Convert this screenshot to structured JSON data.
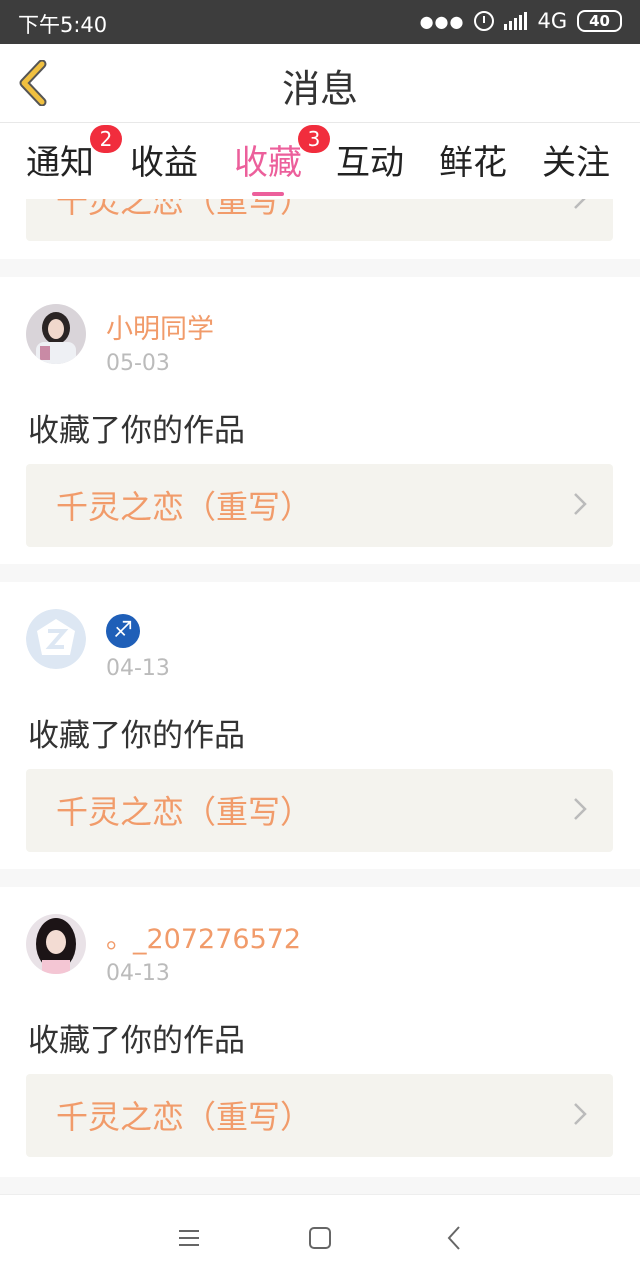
{
  "status_bar": {
    "time": "下午5:40",
    "network": "4G",
    "battery": "40"
  },
  "header": {
    "title": "消息"
  },
  "tabs": [
    {
      "label": "通知",
      "badge": "2",
      "active": false
    },
    {
      "label": "收益",
      "badge": "",
      "active": false
    },
    {
      "label": "收藏",
      "badge": "3",
      "active": true
    },
    {
      "label": "互动",
      "badge": "",
      "active": false
    },
    {
      "label": "鲜花",
      "badge": "",
      "active": false
    },
    {
      "label": "关注",
      "badge": "",
      "active": false
    }
  ],
  "feed": {
    "partial_item": {
      "work_title": "千灵之恋（重写）"
    },
    "items": [
      {
        "username": "小明同学",
        "date": "05-03",
        "action": "收藏了你的作品",
        "work_title": "千灵之恋（重写）"
      },
      {
        "username": "♐",
        "date": "04-13",
        "action": "收藏了你的作品",
        "work_title": "千灵之恋（重写）"
      },
      {
        "username": "。_207276572",
        "date": "04-13",
        "action": "收藏了你的作品",
        "work_title": "千灵之恋（重写）"
      }
    ]
  },
  "colors": {
    "accent_pink": "#ec5f9b",
    "badge_red": "#f12d3d",
    "username_orange": "#f19b6a",
    "work_bg": "#f4f3ee",
    "back_yellow": "#f0c040"
  }
}
